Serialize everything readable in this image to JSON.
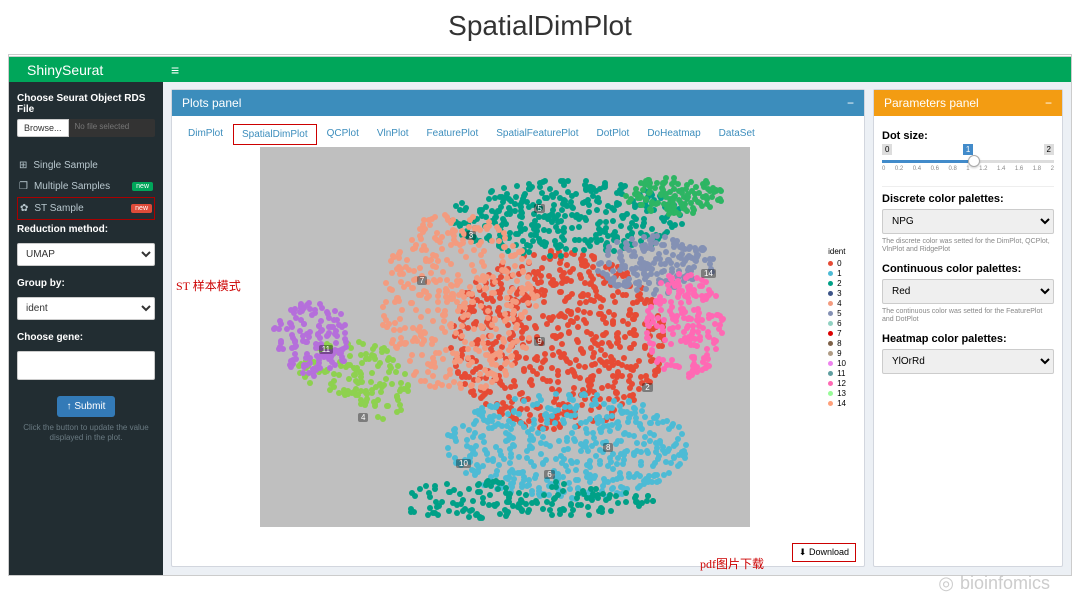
{
  "page_title": "SpatialDimPlot",
  "header": {
    "brand": "ShinySeurat",
    "hamburger": "≡"
  },
  "sidebar": {
    "file_label": "Choose Seurat Object RDS File",
    "browse_btn": "Browse...",
    "file_text": "No file selected",
    "items": [
      {
        "icon": "⊞",
        "label": "Single Sample",
        "badge": ""
      },
      {
        "icon": "❐",
        "label": "Multiple Samples",
        "badge": "new",
        "badge_class": ""
      },
      {
        "icon": "✿",
        "label": "ST Sample",
        "badge": "new",
        "badge_class": "red",
        "boxed": true
      }
    ],
    "reduction_label": "Reduction method:",
    "reduction_value": "UMAP",
    "group_label": "Group by:",
    "group_value": "ident",
    "gene_label": "Choose gene:",
    "submit": "↑ Submit",
    "hint": "Click the button to update the value displayed in the plot."
  },
  "plots_panel": {
    "title": "Plots panel",
    "collapse": "−",
    "tabs": [
      "DimPlot",
      "SpatialDimPlot",
      "QCPlot",
      "VlnPlot",
      "FeaturePlot",
      "SpatialFeaturePlot",
      "DotPlot",
      "DoHeatmap",
      "DataSet"
    ],
    "active_tab": 1,
    "legend_title": "ident",
    "legend_items": [
      {
        "c": "#e64b35",
        "n": "0"
      },
      {
        "c": "#4dbbd5",
        "n": "1"
      },
      {
        "c": "#00a087",
        "n": "2"
      },
      {
        "c": "#3c5488",
        "n": "3"
      },
      {
        "c": "#f39b7f",
        "n": "4"
      },
      {
        "c": "#8491b4",
        "n": "5"
      },
      {
        "c": "#91d1c2",
        "n": "6"
      },
      {
        "c": "#dc0000",
        "n": "7"
      },
      {
        "c": "#7e6148",
        "n": "8"
      },
      {
        "c": "#b09c85",
        "n": "9"
      },
      {
        "c": "#ee82ee",
        "n": "10"
      },
      {
        "c": "#5f9ea0",
        "n": "11"
      },
      {
        "c": "#ff69b4",
        "n": "12"
      },
      {
        "c": "#98fb98",
        "n": "13"
      },
      {
        "c": "#ffa07a",
        "n": "14"
      }
    ],
    "download": "⬇ Download"
  },
  "params_panel": {
    "title": "Parameters panel",
    "collapse": "−",
    "dot_size_label": "Dot size:",
    "dot_size_min": "0",
    "dot_size_max": "2",
    "dot_size_value": "1",
    "dot_size_ticks": [
      "0",
      "0.2",
      "0.4",
      "0.6",
      "0.8",
      "1",
      "1.2",
      "1.4",
      "1.6",
      "1.8",
      "2"
    ],
    "discrete_label": "Discrete color palettes:",
    "discrete_value": "NPG",
    "discrete_hint": "The discrete color was setted for the DimPlot, QCPlot, VlnPlot and RidgePlot",
    "continuous_label": "Continuous color palettes:",
    "continuous_value": "Red",
    "continuous_hint": "The continuous color was setted for the FeaturePlot and DotPlot",
    "heatmap_label": "Heatmap color palettes:",
    "heatmap_value": "YlOrRd"
  },
  "annotations": {
    "st_mode": "ST 样本模式",
    "pdf_download": "pdf图片下载"
  },
  "watermark": "bioinfomics",
  "chart_data": {
    "type": "spatial_scatter",
    "note": "Approximate spatial honeycomb clusters; coordinates are illustrative regions",
    "regions": [
      {
        "cluster": 0,
        "color": "#e64b35",
        "cx": 0.6,
        "cy": 0.5,
        "rx": 0.22,
        "ry": 0.24,
        "n": 600
      },
      {
        "cluster": 1,
        "color": "#4dbbd5",
        "cx": 0.62,
        "cy": 0.78,
        "rx": 0.25,
        "ry": 0.14,
        "n": 450
      },
      {
        "cluster": 2,
        "color": "#00a087",
        "cx": 0.62,
        "cy": 0.18,
        "rx": 0.24,
        "ry": 0.1,
        "n": 350
      },
      {
        "cluster": 3,
        "color": "#f39b7f",
        "cx": 0.4,
        "cy": 0.4,
        "rx": 0.16,
        "ry": 0.24,
        "n": 400
      },
      {
        "cluster": 4,
        "color": "#8ed14f",
        "cx": 0.18,
        "cy": 0.62,
        "rx": 0.12,
        "ry": 0.12,
        "n": 200
      },
      {
        "cluster": 5,
        "color": "#8491b4",
        "cx": 0.8,
        "cy": 0.3,
        "rx": 0.12,
        "ry": 0.08,
        "n": 180
      },
      {
        "cluster": 7,
        "color": "#2db563",
        "cx": 0.84,
        "cy": 0.12,
        "rx": 0.1,
        "ry": 0.05,
        "n": 120
      },
      {
        "cluster": 10,
        "color": "#b56fdb",
        "cx": 0.1,
        "cy": 0.5,
        "rx": 0.08,
        "ry": 0.1,
        "n": 140
      },
      {
        "cluster": 12,
        "color": "#ff69b4",
        "cx": 0.86,
        "cy": 0.46,
        "rx": 0.08,
        "ry": 0.14,
        "n": 180
      },
      {
        "cluster": 2,
        "color": "#00a087",
        "cx": 0.5,
        "cy": 0.92,
        "rx": 0.3,
        "ry": 0.05,
        "n": 180
      }
    ]
  }
}
